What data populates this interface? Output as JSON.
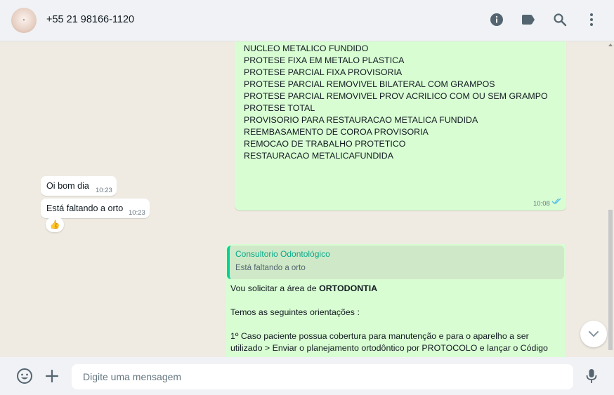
{
  "header": {
    "contact_name": "+55 21 98166-1120",
    "avatar_text": "✦",
    "icons": [
      "info-icon",
      "label-icon",
      "search-icon",
      "menu-icon"
    ]
  },
  "messages": {
    "product_list": [
      "NUCLEO METALICO FUNDIDO",
      "PROTESE FIXA EM METALO PLASTICA",
      "PROTESE PARCIAL FIXA PROVISORIA",
      "PROTESE PARCIAL REMOVIVEL BILATERAL COM GRAMPOS",
      "PROTESE PARCIAL REMOVIVEL PROV ACRILICO COM OU SEM GRAMPO",
      "PROTESE TOTAL",
      "PROVISORIO PARA RESTAURACAO METALICA FUNDIDA",
      "REEMBASAMENTO DE COROA PROVISORIA",
      "REMOCAO DE TRABALHO PROTETICO",
      "RESTAURACAO METALICAFUNDIDA"
    ],
    "product_list_time": "10:08",
    "incoming_1": {
      "text": "Oi bom dia",
      "time": "10:23"
    },
    "incoming_2": {
      "text": "Está faltando a orto",
      "time": "10:23"
    },
    "reaction": "👍",
    "reply": {
      "quote_author": "Consultorio Odontológico",
      "quote_text": "Está faltando a orto",
      "line1_prefix": "Vou solicitar a área de ",
      "line1_bold": "ORTODONTIA",
      "line2": "Temos as seguintes orientações :",
      "line3": "1º Caso paciente possua cobertura para manutenção e para o aparelho a ser",
      "line4": "utilizado > Enviar o planejamento ortodôntico por PROTOCOLO e lançar o Código"
    }
  },
  "composer": {
    "placeholder": "Digite uma mensagem"
  },
  "colors": {
    "outgoing_bubble": "#d9fdd3",
    "incoming_bubble": "#ffffff",
    "accent": "#06cf9c",
    "read_ticks": "#53bdeb"
  }
}
